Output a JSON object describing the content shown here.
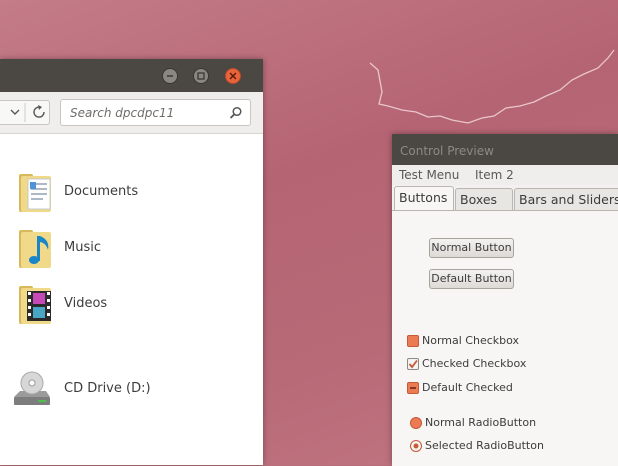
{
  "file_manager": {
    "search": {
      "placeholder": "Search dpcdpc11"
    },
    "items": [
      {
        "label": "Documents",
        "icon": "documents-folder-icon"
      },
      {
        "label": "Music",
        "icon": "music-folder-icon"
      },
      {
        "label": "Videos",
        "icon": "videos-folder-icon"
      },
      {
        "label": "CD Drive (D:)",
        "icon": "cd-drive-icon"
      }
    ],
    "colors": {
      "titlebar": "#4b4742",
      "close": "#e9643b"
    }
  },
  "control_preview": {
    "title": "Control Preview",
    "menu": [
      "Test Menu",
      "Item 2"
    ],
    "tabs": [
      "Buttons",
      "Boxes",
      "Bars and Sliders"
    ],
    "buttons": {
      "normal": "Normal Button",
      "default": "Default Button"
    },
    "checkboxes": {
      "normal": "Normal Checkbox",
      "checked": "Checked Checkbox",
      "default_checked": "Default Checked"
    },
    "radios": {
      "normal": "Normal RadioButton",
      "selected": "Selected RadioButton"
    },
    "colors": {
      "accent": "#ec7a52"
    }
  }
}
